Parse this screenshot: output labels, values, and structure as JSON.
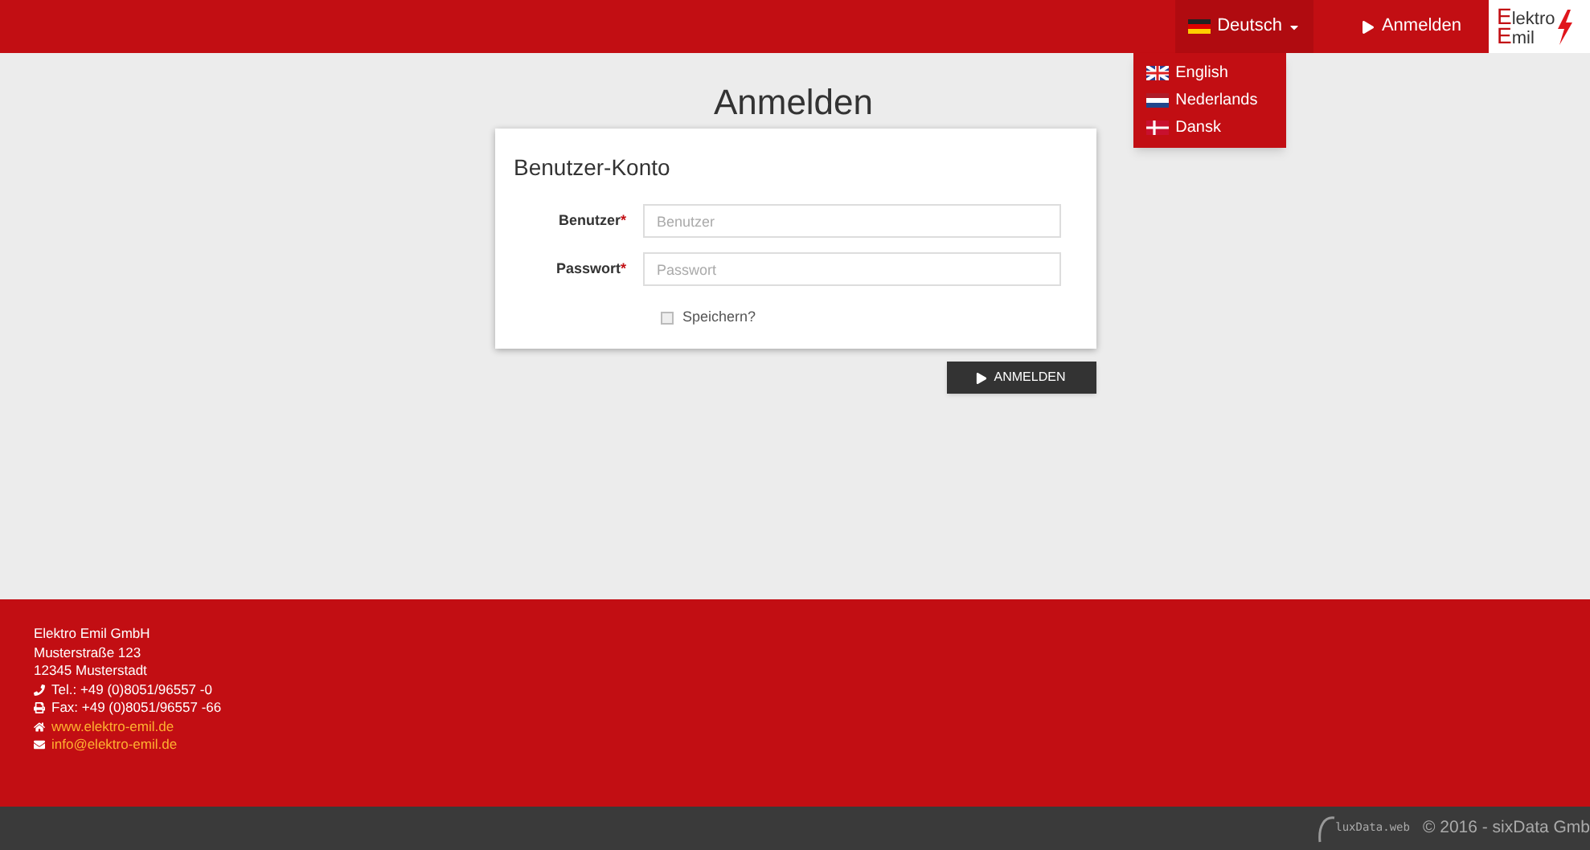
{
  "header": {
    "language": {
      "label": "Deutsch",
      "expanded": true,
      "options": [
        {
          "label": "English",
          "kind": "uk"
        },
        {
          "label": "Nederlands",
          "kind": "nl"
        },
        {
          "label": "Dansk",
          "kind": "dk"
        }
      ]
    },
    "login_link": "Anmelden",
    "logo": [
      {
        "initial": "E",
        "rest": "lektro"
      },
      {
        "initial": "E",
        "rest": "mil"
      }
    ]
  },
  "page_title": "Anmelden",
  "card": {
    "title": "Benutzer-Konto",
    "fields": [
      {
        "label": "Benutzer",
        "required": "*",
        "placeholder": "Benutzer"
      },
      {
        "label": "Passwort",
        "required": "*",
        "placeholder": "Passwort"
      }
    ],
    "remember": {
      "label": "Speichern?",
      "checked": false
    }
  },
  "submit": "ANMELDEN",
  "footer": {
    "address": [
      "Elektro Emil GmbH",
      "Musterstraße 123",
      "12345 Musterstadt"
    ],
    "contacts": [
      {
        "kind": "phone",
        "text": "Tel.: +49 (0)8051/96557 -0"
      },
      {
        "kind": "fax",
        "text": "Fax: +49 (0)8051/96557 -66"
      },
      {
        "kind": "web",
        "text": "www.elektro-emil.de"
      },
      {
        "kind": "mail",
        "text": "info@elektro-emil.de"
      }
    ]
  },
  "bottom_bar": {
    "brand": "luxData.web",
    "copyright": "© 2016 - sixData Gmb"
  }
}
